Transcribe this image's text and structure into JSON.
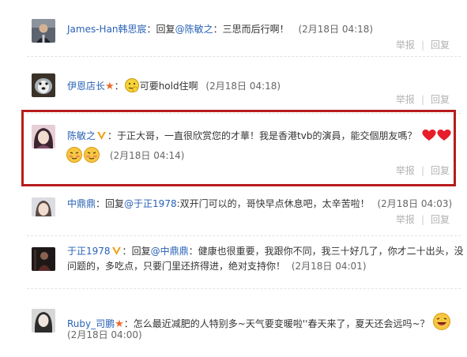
{
  "comments": [
    {
      "username": "James-Han韩思宸",
      "colon": "：",
      "reply_prefix": "回复",
      "mention": "@陈敏之",
      "mention_colon": "：",
      "text": "三思而后行啊！",
      "timestamp": "(2月18日 04:18)",
      "report_label": "举报",
      "reply_label": "回复"
    },
    {
      "username": "伊恩店长",
      "colon": "：",
      "text": "可要hold住啊",
      "timestamp": "(2月18日 04:18)",
      "report_label": "举报",
      "reply_label": "回复"
    },
    {
      "username": "陈敏之",
      "colon": "：",
      "text": "于正大哥，一直很欣赏您的才華！我是香港tvb的演員，能交個朋友嗎？",
      "timestamp": "(2月18日 04:14)",
      "report_label": "举报",
      "reply_label": "回复"
    },
    {
      "username": "中鼎鼎",
      "colon": "：",
      "reply_prefix": "回复",
      "mention": "@于正1978",
      "mention_colon": ":",
      "text": "双开门可以的，哥快早点休息吧，太辛苦啦！",
      "timestamp": "(2月18日 04:03)",
      "report_label": "举报",
      "reply_label": "回复"
    },
    {
      "username": "于正1978",
      "colon": "：",
      "reply_prefix": "回复",
      "mention": "@中鼎鼎",
      "mention_colon": "：",
      "text": "健康也很重要，我跟你不同，我三十好几了，你才二十出头，没",
      "text_line2": "问题的，多吃点，只要门里还挤得进，绝对支持你！",
      "timestamp": "(2月18日 04:01)"
    },
    {
      "username": "Ruby_司鹏",
      "colon": "：",
      "text": "怎么最近减肥的人特别多~天气要变暖啦''春天来了，夏天还会远吗~？",
      "timestamp": "(2月18日 04:00)"
    }
  ],
  "colors": {
    "link": "#2a62b6",
    "highlight_border": "#b81c1c",
    "muted": "#b3b3b3"
  }
}
